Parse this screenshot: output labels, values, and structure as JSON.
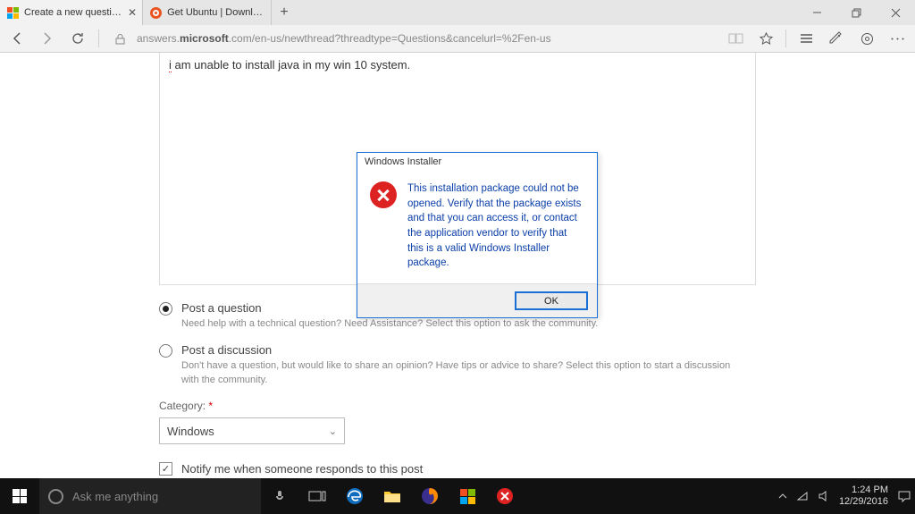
{
  "browser": {
    "tabs": [
      {
        "title": "Create a new question c",
        "active": true,
        "favicon": "ms"
      },
      {
        "title": "Get Ubuntu | Download | Ub",
        "active": false,
        "favicon": "ubuntu"
      }
    ],
    "url_prefix": "answers.",
    "url_host": "microsoft",
    "url_rest": ".com/en-us/newthread?threadtype=Questions&cancelurl=%2Fen-us"
  },
  "editor": {
    "text_prefix": "i",
    "text_rest": " am unable to install java in my win 10 system."
  },
  "post_options": {
    "question": {
      "label": "Post a question",
      "desc": "Need help with a technical question? Need Assistance? Select this option to ask the community."
    },
    "discussion": {
      "label": "Post a discussion",
      "desc": "Don't have a question, but would like to share an opinion? Have tips or advice to share? Select this option to start a discussion with the community."
    }
  },
  "category": {
    "label": "Category:",
    "value": "Windows"
  },
  "notify": {
    "label": "Notify me when someone responds to this post"
  },
  "dialog": {
    "title": "Windows Installer",
    "message": "This installation package could not be opened.  Verify that the package exists and that you can access it, or contact the application vendor to verify that this is a valid Windows Installer package.",
    "ok": "OK"
  },
  "taskbar": {
    "search_placeholder": "Ask me anything",
    "time": "1:24 PM",
    "date": "12/29/2016"
  }
}
